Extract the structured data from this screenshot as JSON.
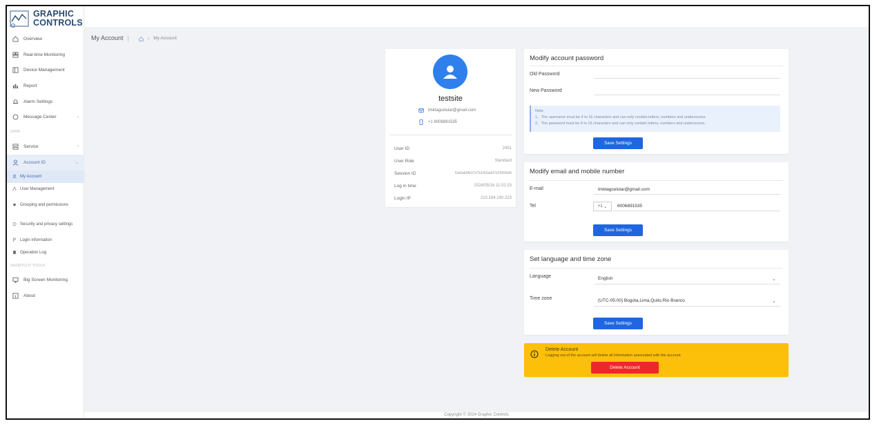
{
  "brand": {
    "line1": "GRAPHIC",
    "line2": "CONTROLS"
  },
  "sidebar": {
    "items": [
      {
        "label": "Overview",
        "icon": "home-icon"
      },
      {
        "label": "Real-time Monitoring",
        "icon": "monitor-grid-icon"
      },
      {
        "label": "Device Management",
        "icon": "device-icon"
      },
      {
        "label": "Report",
        "icon": "report-icon"
      },
      {
        "label": "Alarm Settings",
        "icon": "bell-icon"
      },
      {
        "label": "Message Center",
        "icon": "chat-icon"
      }
    ],
    "group_label": "DATA",
    "service": {
      "label": "Service",
      "icon": "service-icon"
    },
    "account": {
      "label": "Account ID",
      "icon": "user-icon"
    },
    "account_sub": [
      {
        "label": "My Account",
        "icon": "user-small-icon"
      },
      {
        "label": "User Management",
        "icon": "users-icon"
      },
      {
        "label": "Grouping and permissions",
        "icon": "group-icon"
      },
      {
        "label": "Security and privacy settings",
        "icon": "shield-icon"
      },
      {
        "label": "Login information",
        "icon": "login-icon"
      },
      {
        "label": "Operation Log",
        "icon": "log-icon"
      }
    ],
    "group_label2": "SHORTCUT TOOLS",
    "bottom": [
      {
        "label": "Big Screen Monitoring",
        "icon": "screen-icon"
      },
      {
        "label": "About",
        "icon": "info-icon"
      }
    ]
  },
  "breadcrumb": {
    "title": "My Account",
    "current": "My Account"
  },
  "profile": {
    "name": "testsite",
    "email": "tmktagcelular@gmail.com",
    "phone": "+1 6006891535",
    "rows": [
      {
        "label": "User ID",
        "value": "2451"
      },
      {
        "label": "User Role",
        "value": "Standard"
      },
      {
        "label": "Session ID",
        "value": "f3a0ab9fb37e7b1f63ad07d15006d6"
      },
      {
        "label": "Log in time",
        "value": "2024/05/16 11:02:23"
      },
      {
        "label": "Login IP",
        "value": "210.184.190.223"
      }
    ]
  },
  "password": {
    "title": "Modify account password",
    "old_label": "Old Password",
    "new_label": "New Password",
    "note_title": "Note:",
    "note_1": "1、The username must be 4 to 16 characters and can only contain letters, numbers and underscores.",
    "note_2": "2、The password must be 6 to 16 characters and can only contain letters, numbers and underscores.",
    "save_label": "Save Settings"
  },
  "contact": {
    "title": "Modify email and mobile number",
    "email_label": "E-mail",
    "email_value": "tmktagcelular@gmail.com",
    "tel_label": "Tel",
    "country_code": "+1",
    "tel_value": "6006891535",
    "save_label": "Save Settings"
  },
  "locale": {
    "title": "Set language and time zone",
    "language_label": "Language",
    "language_value": "English",
    "tz_label": "Time zone",
    "tz_value": "(UTC-05:00) Bogota,Lima,Quito,Rio Branco",
    "save_label": "Save Settings"
  },
  "delete_account": {
    "title": "Delete Account",
    "description": "Logging out of the account will delete all information associated with the account.",
    "button_label": "Delete Account"
  },
  "footer": {
    "text": "Copyright © 2024 Graphic Controls"
  },
  "colors": {
    "primary": "#1f66e0",
    "danger": "#f1262b",
    "warning": "#fcbf0a",
    "avatar": "#2f80ed"
  }
}
